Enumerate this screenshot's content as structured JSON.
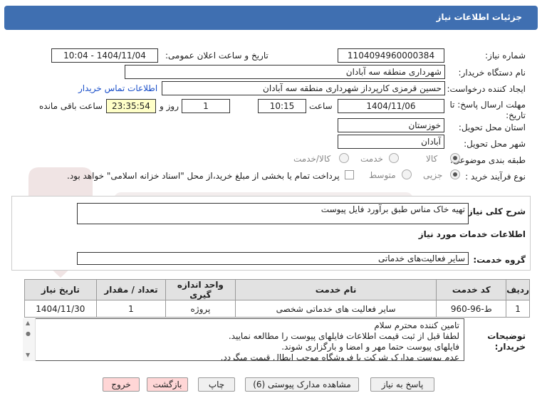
{
  "header": {
    "title": "جزئیات اطلاعات نیاز"
  },
  "fields": {
    "need_number_label": "شماره نیاز:",
    "need_number": "1104094960000384",
    "announce_label": "تاریخ و ساعت اعلان عمومی:",
    "announce_value": "1404/11/04 - 10:04",
    "buyer_org_label": "نام دستگاه خریدار:",
    "buyer_org": "شهرداری منطقه سه آبادان",
    "requester_label": "ایجاد کننده درخواست:",
    "requester": "حسین قرمزی کارپرداز شهرداری منطقه سه آبادان",
    "contact_link": "اطلاعات تماس خریدار",
    "deadline_label_1": "مهلت ارسال پاسخ: تا",
    "deadline_label_2": "تاریخ:",
    "deadline_date": "1404/11/06",
    "time_label": "ساعت",
    "deadline_time": "10:15",
    "days": "1",
    "days_label": "روز و",
    "remaining": "23:35:54",
    "remaining_label": "ساعت باقی مانده",
    "province_label": "استان محل تحویل:",
    "province": "خوزستان",
    "city_label": "شهر محل تحویل:",
    "city": "آبادان",
    "category_label": "طبقه بندی موضوعی:",
    "category_options": [
      "کالا",
      "خدمت",
      "کالا/خدمت"
    ],
    "process_label": "نوع فرآیند خرید :",
    "process_options": [
      "جزیی",
      "متوسط"
    ],
    "payment_note": "پرداخت تمام یا بخشی از مبلغ خرید،از محل \"اسناد خزانه اسلامی\" خواهد بود."
  },
  "description": {
    "label": "شرح کلی نیاز:",
    "value": "تهیه خاک مناس طبق برآورد فایل پیوست"
  },
  "services": {
    "title": "اطلاعات خدمات مورد نیاز",
    "group_label": "گروه خدمت:",
    "group_value": "سایر فعالیت‌های خدماتی"
  },
  "table": {
    "headers": [
      "ردیف",
      "کد خدمت",
      "نام خدمت",
      "واحد اندازه گیری",
      "تعداد / مقدار",
      "تاریخ نیاز"
    ],
    "rows": [
      [
        "1",
        "ط-96-960",
        "سایر فعالیت های خدماتی شخصی",
        "پروژه",
        "1",
        "1404/11/30"
      ]
    ]
  },
  "notes": {
    "label_1": "توضیحات",
    "label_2": "خریدار:",
    "lines": [
      "تامین کننده محترم سلام",
      "لطفا قبل از ثبت قیمت اطلاعات فایلهای پیوست را مطالعه نمایید.",
      "فایلهای پیوست حتما مهر و امضا و بارگزاری شوند.",
      "عدم پیوست مدارک شرکت یا فروشگاه موجب ابطال قیمت میگردد."
    ]
  },
  "buttons": {
    "reply": "پاسخ به نیاز",
    "docs": "مشاهده مدارک پیوستی (6)",
    "print": "چاپ",
    "back": "بازگشت",
    "exit": "خروج"
  },
  "colors": {
    "header": "#3f6fb1",
    "link": "#1a4fc9",
    "remaining_bg": "#ffffc8"
  }
}
